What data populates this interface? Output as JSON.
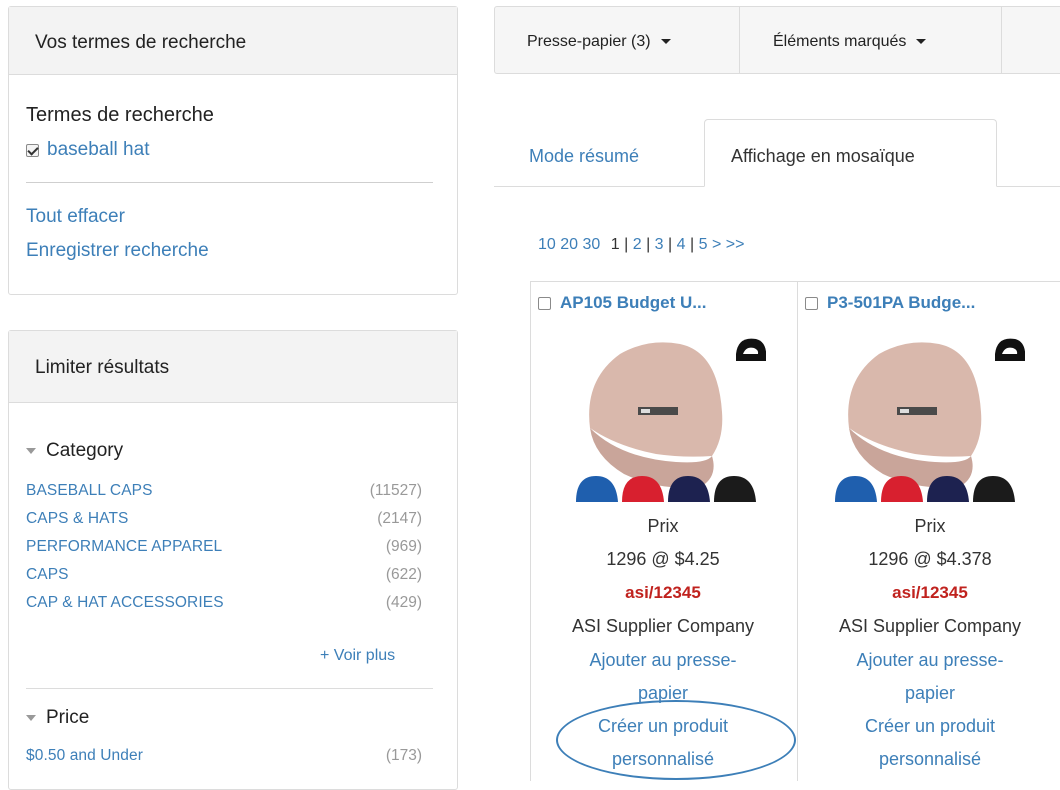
{
  "search_panel": {
    "header": "Vos termes de recherche",
    "terms_title": "Termes de recherche",
    "term": "baseball hat",
    "clear_all": "Tout effacer",
    "save_search": "Enregistrer recherche"
  },
  "filter_panel": {
    "header": "Limiter résultats",
    "category_title": "Category",
    "categories": [
      {
        "label": "BASEBALL CAPS",
        "count": "(11527)"
      },
      {
        "label": "CAPS & HATS",
        "count": "(2147)"
      },
      {
        "label": "PERFORMANCE APPAREL",
        "count": "(969)"
      },
      {
        "label": "CAPS",
        "count": "(622)"
      },
      {
        "label": "CAP & HAT ACCESSORIES",
        "count": "(429)"
      }
    ],
    "see_more": "+ Voir plus",
    "price_title": "Price",
    "prices": [
      {
        "label": "$0.50 and Under",
        "count": "(173)"
      }
    ]
  },
  "toolbar": {
    "clipboard": "Presse-papier (3)",
    "marked": "Éléments marqués"
  },
  "tabs": {
    "summary": "Mode résumé",
    "tile": "Affichage en mosaïque"
  },
  "pager": {
    "sizes": "10 20 30",
    "current": "1",
    "sep": "|",
    "p2": "2",
    "p3": "3",
    "p4": "4",
    "p5": "5",
    "next": ">",
    "last": ">>"
  },
  "products": [
    {
      "title": "AP105  Budget U...",
      "price_label": "Prix",
      "price": "1296 @ $4.25",
      "asi": "asi/12345",
      "supplier": "ASI Supplier Company",
      "add_clip_1": "Ajouter au presse-",
      "add_clip_2": "papier",
      "custom_1": "Créer un produit",
      "custom_2": "personnalisé"
    },
    {
      "title": "P3-501PA  Budge...",
      "price_label": "Prix",
      "price": "1296 @ $4.378",
      "asi": "asi/12345",
      "supplier": "ASI Supplier Company",
      "add_clip_1": "Ajouter au presse-",
      "add_clip_2": "papier",
      "custom_1": "Créer un produit",
      "custom_2": "personnalisé"
    }
  ],
  "colors": {
    "link": "#3d7fb8",
    "asi_red": "#c0221e",
    "cap_main": "#d9b8ac",
    "swatches": [
      "#1f5fae",
      "#d8202f",
      "#1d2250",
      "#1b1b1b"
    ]
  }
}
